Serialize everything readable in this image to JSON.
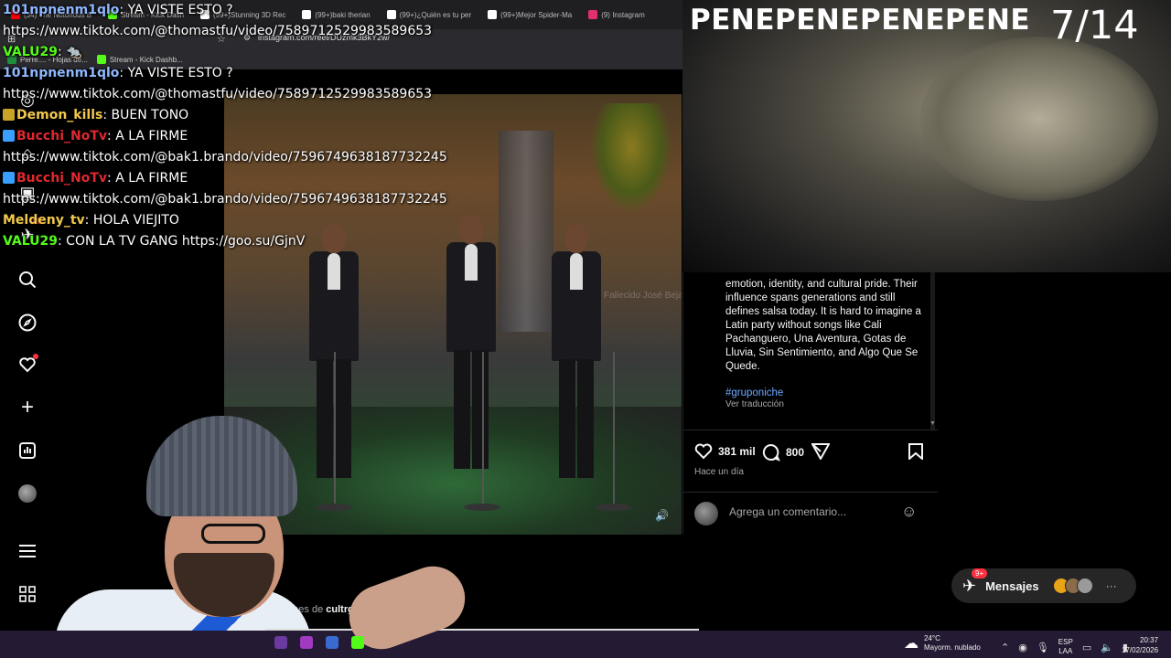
{
  "browser": {
    "tabs": [
      {
        "label": "(34) The Notorious B",
        "color": "#ff0000"
      },
      {
        "label": "Stream - Kick Dash",
        "color": "#53fc18"
      },
      {
        "label": "(99+)Stunning 3D Rec",
        "color": "#ffffff"
      },
      {
        "label": "(99+)baki therian",
        "color": "#ffffff"
      },
      {
        "label": "(99+)¿Quién es tu per",
        "color": "#ffffff"
      },
      {
        "label": "(99+)Mejor Spider-Ma",
        "color": "#ffffff"
      },
      {
        "label": "(9) Instagram",
        "color": "#e1306c"
      }
    ],
    "url": "instagram.com/reel/DUzmk3BkY2w/",
    "bookmarks": [
      {
        "label": "Perre.... - Hojas de...",
        "color": "#1e8e3e"
      },
      {
        "label": "Stream - Kick Dashb...",
        "color": "#53fc18"
      }
    ]
  },
  "overlay": {
    "title": "PENEPENEPENEPENE",
    "counter": "7/14"
  },
  "chat": [
    {
      "user": "101npnenm1qlo",
      "user_color": "#8fb8ff",
      "message": "YA VISTE ESTO ?",
      "badge": ""
    },
    {
      "user": "",
      "user_color": "#ffffff",
      "message": "https://www.tiktok.com/@thomastfu/video/7589712529983589653",
      "badge": ""
    },
    {
      "user": "VALU29",
      "user_color": "#53fc18",
      "message": "🐀",
      "badge": ""
    },
    {
      "user": "101npnenm1qlo",
      "user_color": "#8fb8ff",
      "message": "YA VISTE ESTO ?",
      "badge": ""
    },
    {
      "user": "",
      "user_color": "#ffffff",
      "message": "https://www.tiktok.com/@thomastfu/video/7589712529983589653",
      "badge": ""
    },
    {
      "user": "Demon_kills",
      "user_color": "#f2c94c",
      "message": "BUEN TONO",
      "badge": "#c9a227"
    },
    {
      "user": "Bucchi_NoTv",
      "user_color": "#e0282e",
      "message": "A LA FIRME",
      "badge": "#3aa0ff"
    },
    {
      "user": "",
      "user_color": "#ffffff",
      "message": "https://www.tiktok.com/@bak1.brando/video/7596749638187732245",
      "badge": ""
    },
    {
      "user": "Bucchi_NoTv",
      "user_color": "#e0282e",
      "message": "A LA FIRME",
      "badge": "#3aa0ff"
    },
    {
      "user": "",
      "user_color": "#ffffff",
      "message": "https://www.tiktok.com/@bak1.brando/video/7596749638187732245",
      "badge": ""
    },
    {
      "user": "Meldeny_tv",
      "user_color": "#f2c94c",
      "message": "HOLA VIEJITO",
      "badge": ""
    },
    {
      "user": "VALU29",
      "user_color": "#53fc18",
      "message": "CON LA TV GANG https://goo.su/GjnV",
      "badge": ""
    }
  ],
  "instagram": {
    "rail_icons": [
      "home-icon",
      "reels-icon",
      "messenger-icon",
      "search-icon",
      "explore-icon",
      "heart-icon",
      "create-icon",
      "insights-icon",
      "profile-avatar",
      "menu-icon",
      "apps-icon"
    ],
    "video_overlay_text": "Fallecido José Bejarano",
    "caption": "emotion, identity, and cultural pride. Their influence spans generations and still defines salsa today. It is hard to imagine a Latin party without songs like Cali Pachanguero, Una Aventura, Gotas de Lluvia, Sin Sentimiento, and Algo Que Se Quede.",
    "hashtag": "#gruponiche",
    "translate_label": "Ver traducción",
    "likes": "381 mil",
    "comments": "800",
    "time_ago": "Hace un día",
    "comment_placeholder": "Agrega un comentario...",
    "bottom_text_prefix": "aciones de",
    "bottom_text_user": "cultrgio",
    "messages_label": "Mensajes",
    "messages_badge": "9+",
    "notif_badge": "9+"
  },
  "taskbar": {
    "weather_temp": "24°C",
    "weather_desc": "Mayorm. nublado",
    "lang_top": "ESP",
    "lang_bottom": "LAA",
    "time": "20:37",
    "date": "17/02/2026"
  }
}
